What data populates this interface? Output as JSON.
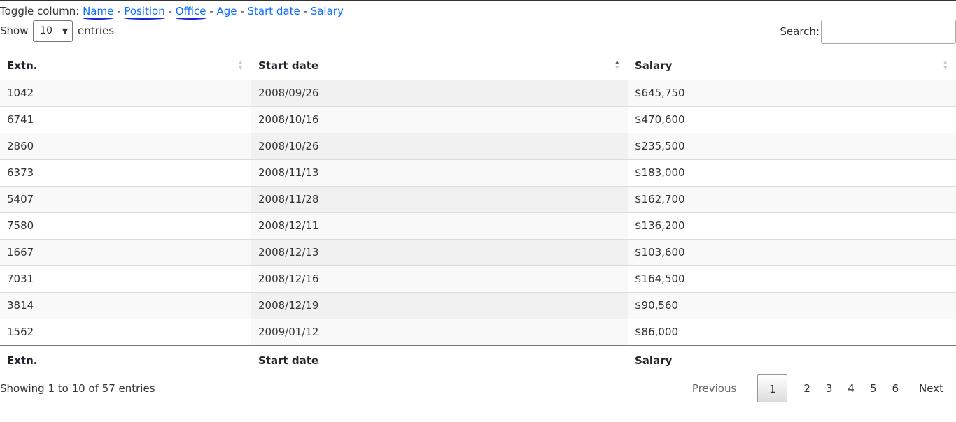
{
  "toggle": {
    "prefix": "Toggle column:",
    "sep": "-",
    "columns": [
      "Name",
      "Position",
      "Office",
      "Age",
      "Start date",
      "Salary"
    ]
  },
  "length": {
    "show": "Show",
    "value": "10",
    "entries": "entries"
  },
  "search": {
    "label": "Search:",
    "value": ""
  },
  "table": {
    "headers": [
      "Extn.",
      "Start date",
      "Salary"
    ],
    "rows": [
      [
        "1042",
        "2008/09/26",
        "$645,750"
      ],
      [
        "6741",
        "2008/10/16",
        "$470,600"
      ],
      [
        "2860",
        "2008/10/26",
        "$235,500"
      ],
      [
        "6373",
        "2008/11/13",
        "$183,000"
      ],
      [
        "5407",
        "2008/11/28",
        "$162,700"
      ],
      [
        "7580",
        "2008/12/11",
        "$136,200"
      ],
      [
        "1667",
        "2008/12/13",
        "$103,600"
      ],
      [
        "7031",
        "2008/12/16",
        "$164,500"
      ],
      [
        "3814",
        "2008/12/19",
        "$90,560"
      ],
      [
        "1562",
        "2009/01/12",
        "$86,000"
      ]
    ],
    "footers": [
      "Extn.",
      "Start date",
      "Salary"
    ]
  },
  "info": "Showing 1 to 10 of 57 entries",
  "pagination": {
    "previous": "Previous",
    "pages": [
      "1",
      "2",
      "3",
      "4",
      "5",
      "6"
    ],
    "next": "Next"
  },
  "colors": {
    "link": "#0d6efd",
    "annotation": "#1a2bd6"
  }
}
